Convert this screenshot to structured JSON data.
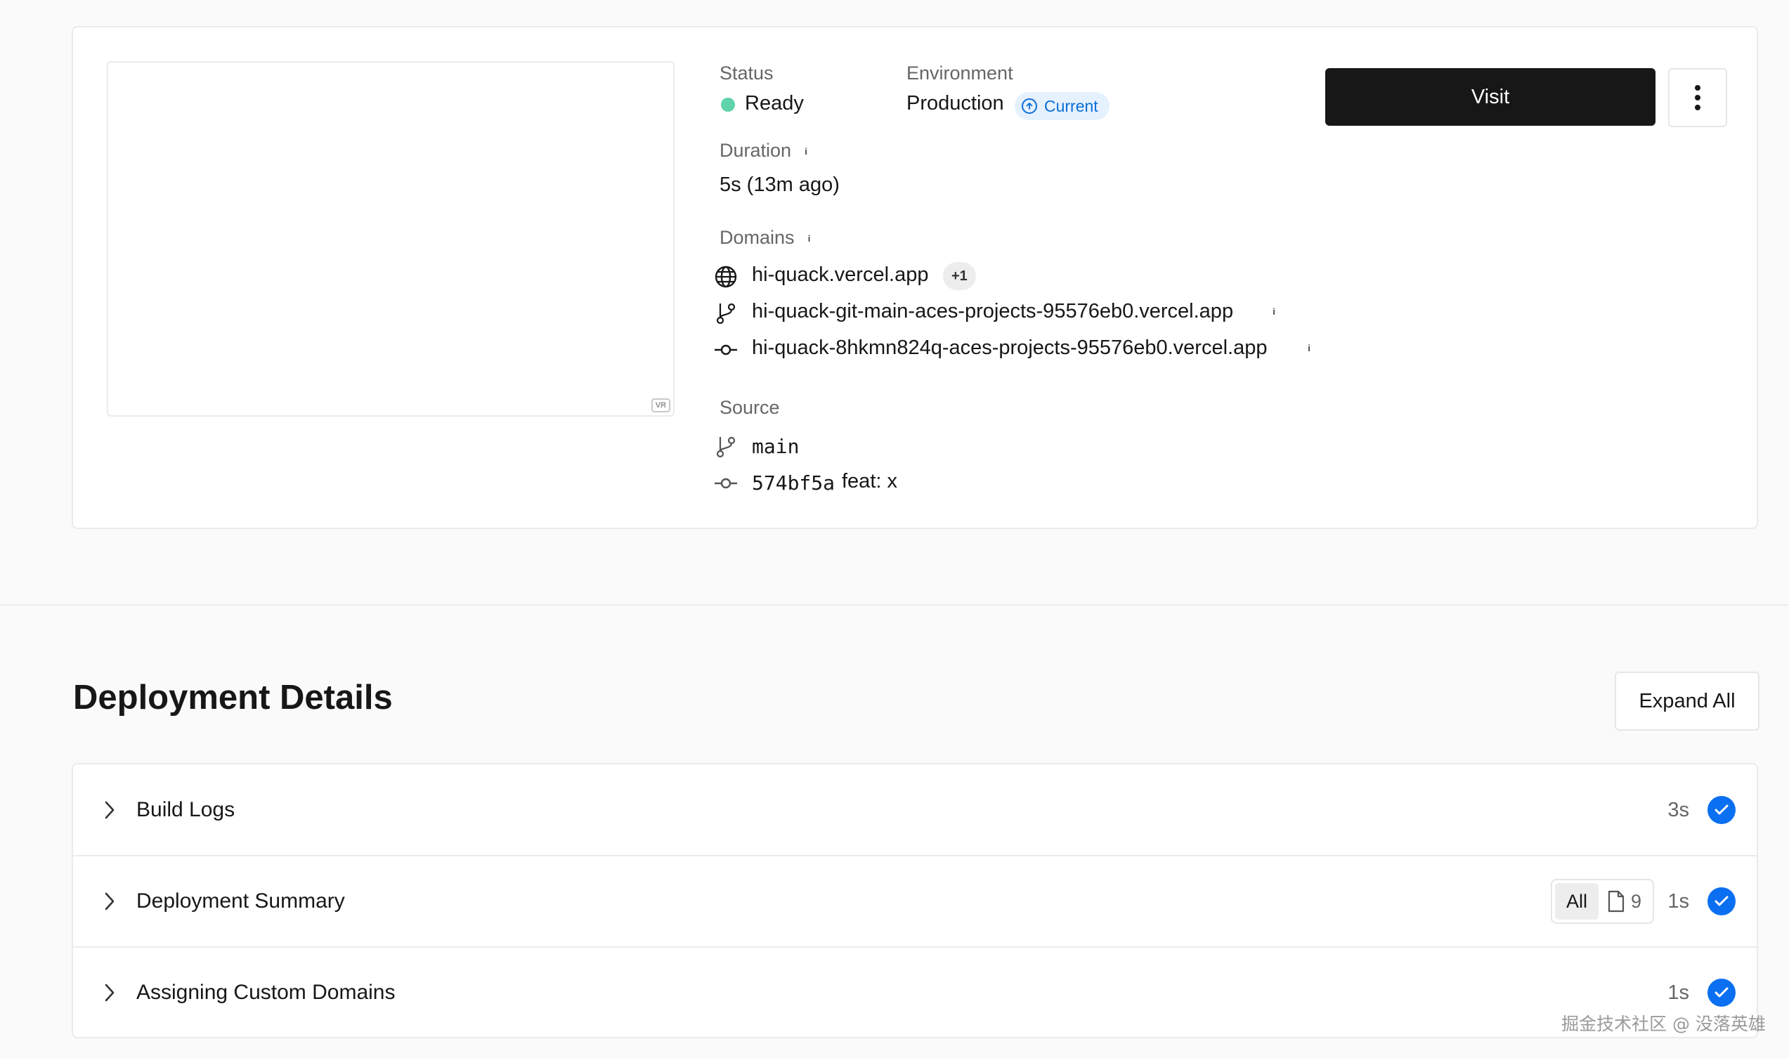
{
  "overview": {
    "preview": {
      "badge": "VR"
    },
    "status": {
      "label": "Status",
      "value": "Ready",
      "dot_color": "#5fd3a9"
    },
    "environment": {
      "label": "Environment",
      "value": "Production",
      "badge": "Current",
      "badge_icon": "arrow-up-circle-icon"
    },
    "duration": {
      "label": "Duration",
      "value": "5s (13m ago)"
    },
    "domains": {
      "label": "Domains",
      "items": [
        {
          "icon": "globe-icon",
          "text": "hi-quack.vercel.app",
          "extra": "+1"
        },
        {
          "icon": "git-branch-icon",
          "text": "hi-quack-git-main-aces-projects-95576eb0.vercel.app"
        },
        {
          "icon": "git-commit-icon",
          "text": "hi-quack-8hkmn824q-aces-projects-95576eb0.vercel.app"
        }
      ]
    },
    "source": {
      "label": "Source",
      "branch": "main",
      "commit_hash": "574bf5a",
      "commit_message": "feat: x"
    },
    "visit_label": "Visit",
    "more_icon": "more-vertical-icon"
  },
  "details": {
    "title": "Deployment Details",
    "expand_label": "Expand All",
    "rows": [
      {
        "title": "Build Logs",
        "time": "3s",
        "status": "success"
      },
      {
        "title": "Deployment Summary",
        "time": "1s",
        "status": "success",
        "filter_all": "All",
        "file_count": "9"
      },
      {
        "title": "Assigning Custom Domains",
        "time": "1s",
        "status": "success"
      }
    ],
    "check_color": "#0a6ff0"
  },
  "watermark": "掘金技术社区 @ 没落英雄"
}
